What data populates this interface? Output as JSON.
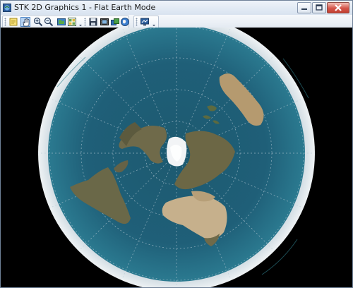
{
  "window": {
    "title": "STK 2D Graphics 1 - Flat Earth Mode"
  },
  "window_controls": [
    {
      "name": "minimize-button",
      "icon": "minimize-icon"
    },
    {
      "name": "maximize-button",
      "icon": "maximize-icon"
    },
    {
      "name": "close-button",
      "icon": "close-icon"
    }
  ],
  "toolbar": {
    "buttons": [
      {
        "name": "properties-button",
        "icon": "note-icon"
      },
      {
        "name": "pan-button",
        "icon": "hand-icon",
        "active": true
      },
      {
        "name": "zoom-in-button",
        "icon": "zoom-in-icon"
      },
      {
        "name": "zoom-out-button",
        "icon": "zoom-out-icon"
      },
      {
        "name": "map-view-button",
        "icon": "map-icon"
      },
      {
        "name": "details-button",
        "icon": "grid-icon"
      },
      {
        "name": "save-image-button",
        "icon": "floppy-icon"
      },
      {
        "name": "record-button",
        "icon": "film-icon"
      },
      {
        "name": "layers-button",
        "icon": "layers-icon"
      },
      {
        "name": "globe-button",
        "icon": "globe-icon"
      },
      {
        "name": "3d-view-button",
        "icon": "monitor-icon"
      }
    ]
  },
  "map": {
    "projection": "polar azimuthal (flat earth)",
    "ocean_color": "#1f5a72",
    "land_color": "#6f6a4a",
    "ice_color": "#f2f4f6",
    "rim_color": "#d8e2e8",
    "background_color": "#000000"
  }
}
